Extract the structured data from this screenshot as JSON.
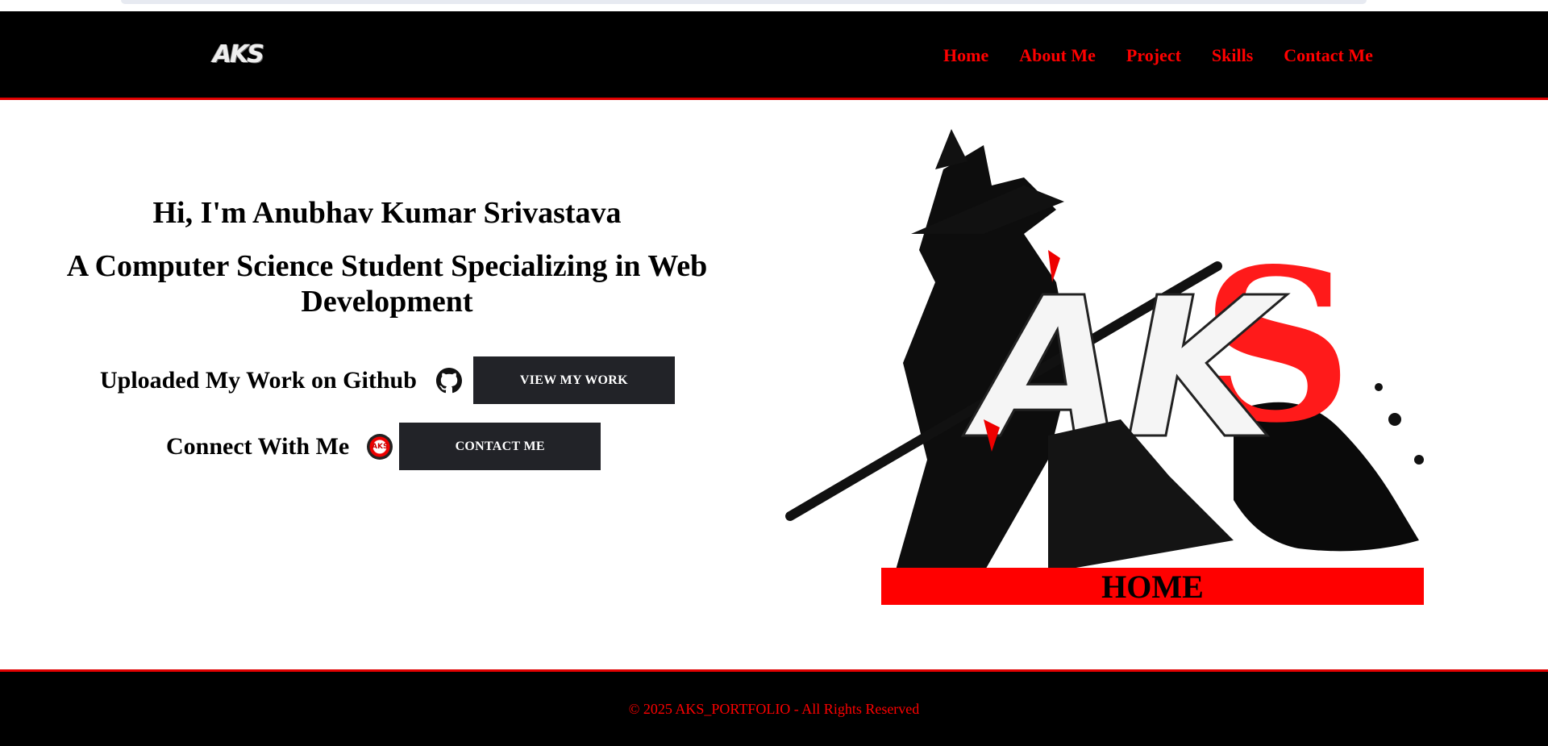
{
  "navbar": {
    "logo_text": "AKS",
    "links": [
      "Home",
      "About Me",
      "Project",
      "Skills",
      "Contact Me"
    ]
  },
  "hero": {
    "greeting": "Hi, I'm Anubhav Kumar Srivastava",
    "subtitle": "A Computer Science Student Specializing in Web Development",
    "github_label": "Uploaded My Work on Github",
    "view_work_button": "VIEW MY WORK",
    "connect_label": "Connect With Me",
    "contact_button": "CONTACT ME",
    "avatar_text": "AKS"
  },
  "art": {
    "logo_letters": "AKS",
    "banner_label": "HOME"
  },
  "footer": {
    "copyright": "© 2025 AKS_PORTFOLIO - All Rights Reserved"
  },
  "colors": {
    "accent": "#ff0000",
    "navbar_bg": "#000000",
    "button_bg": "#222328"
  }
}
